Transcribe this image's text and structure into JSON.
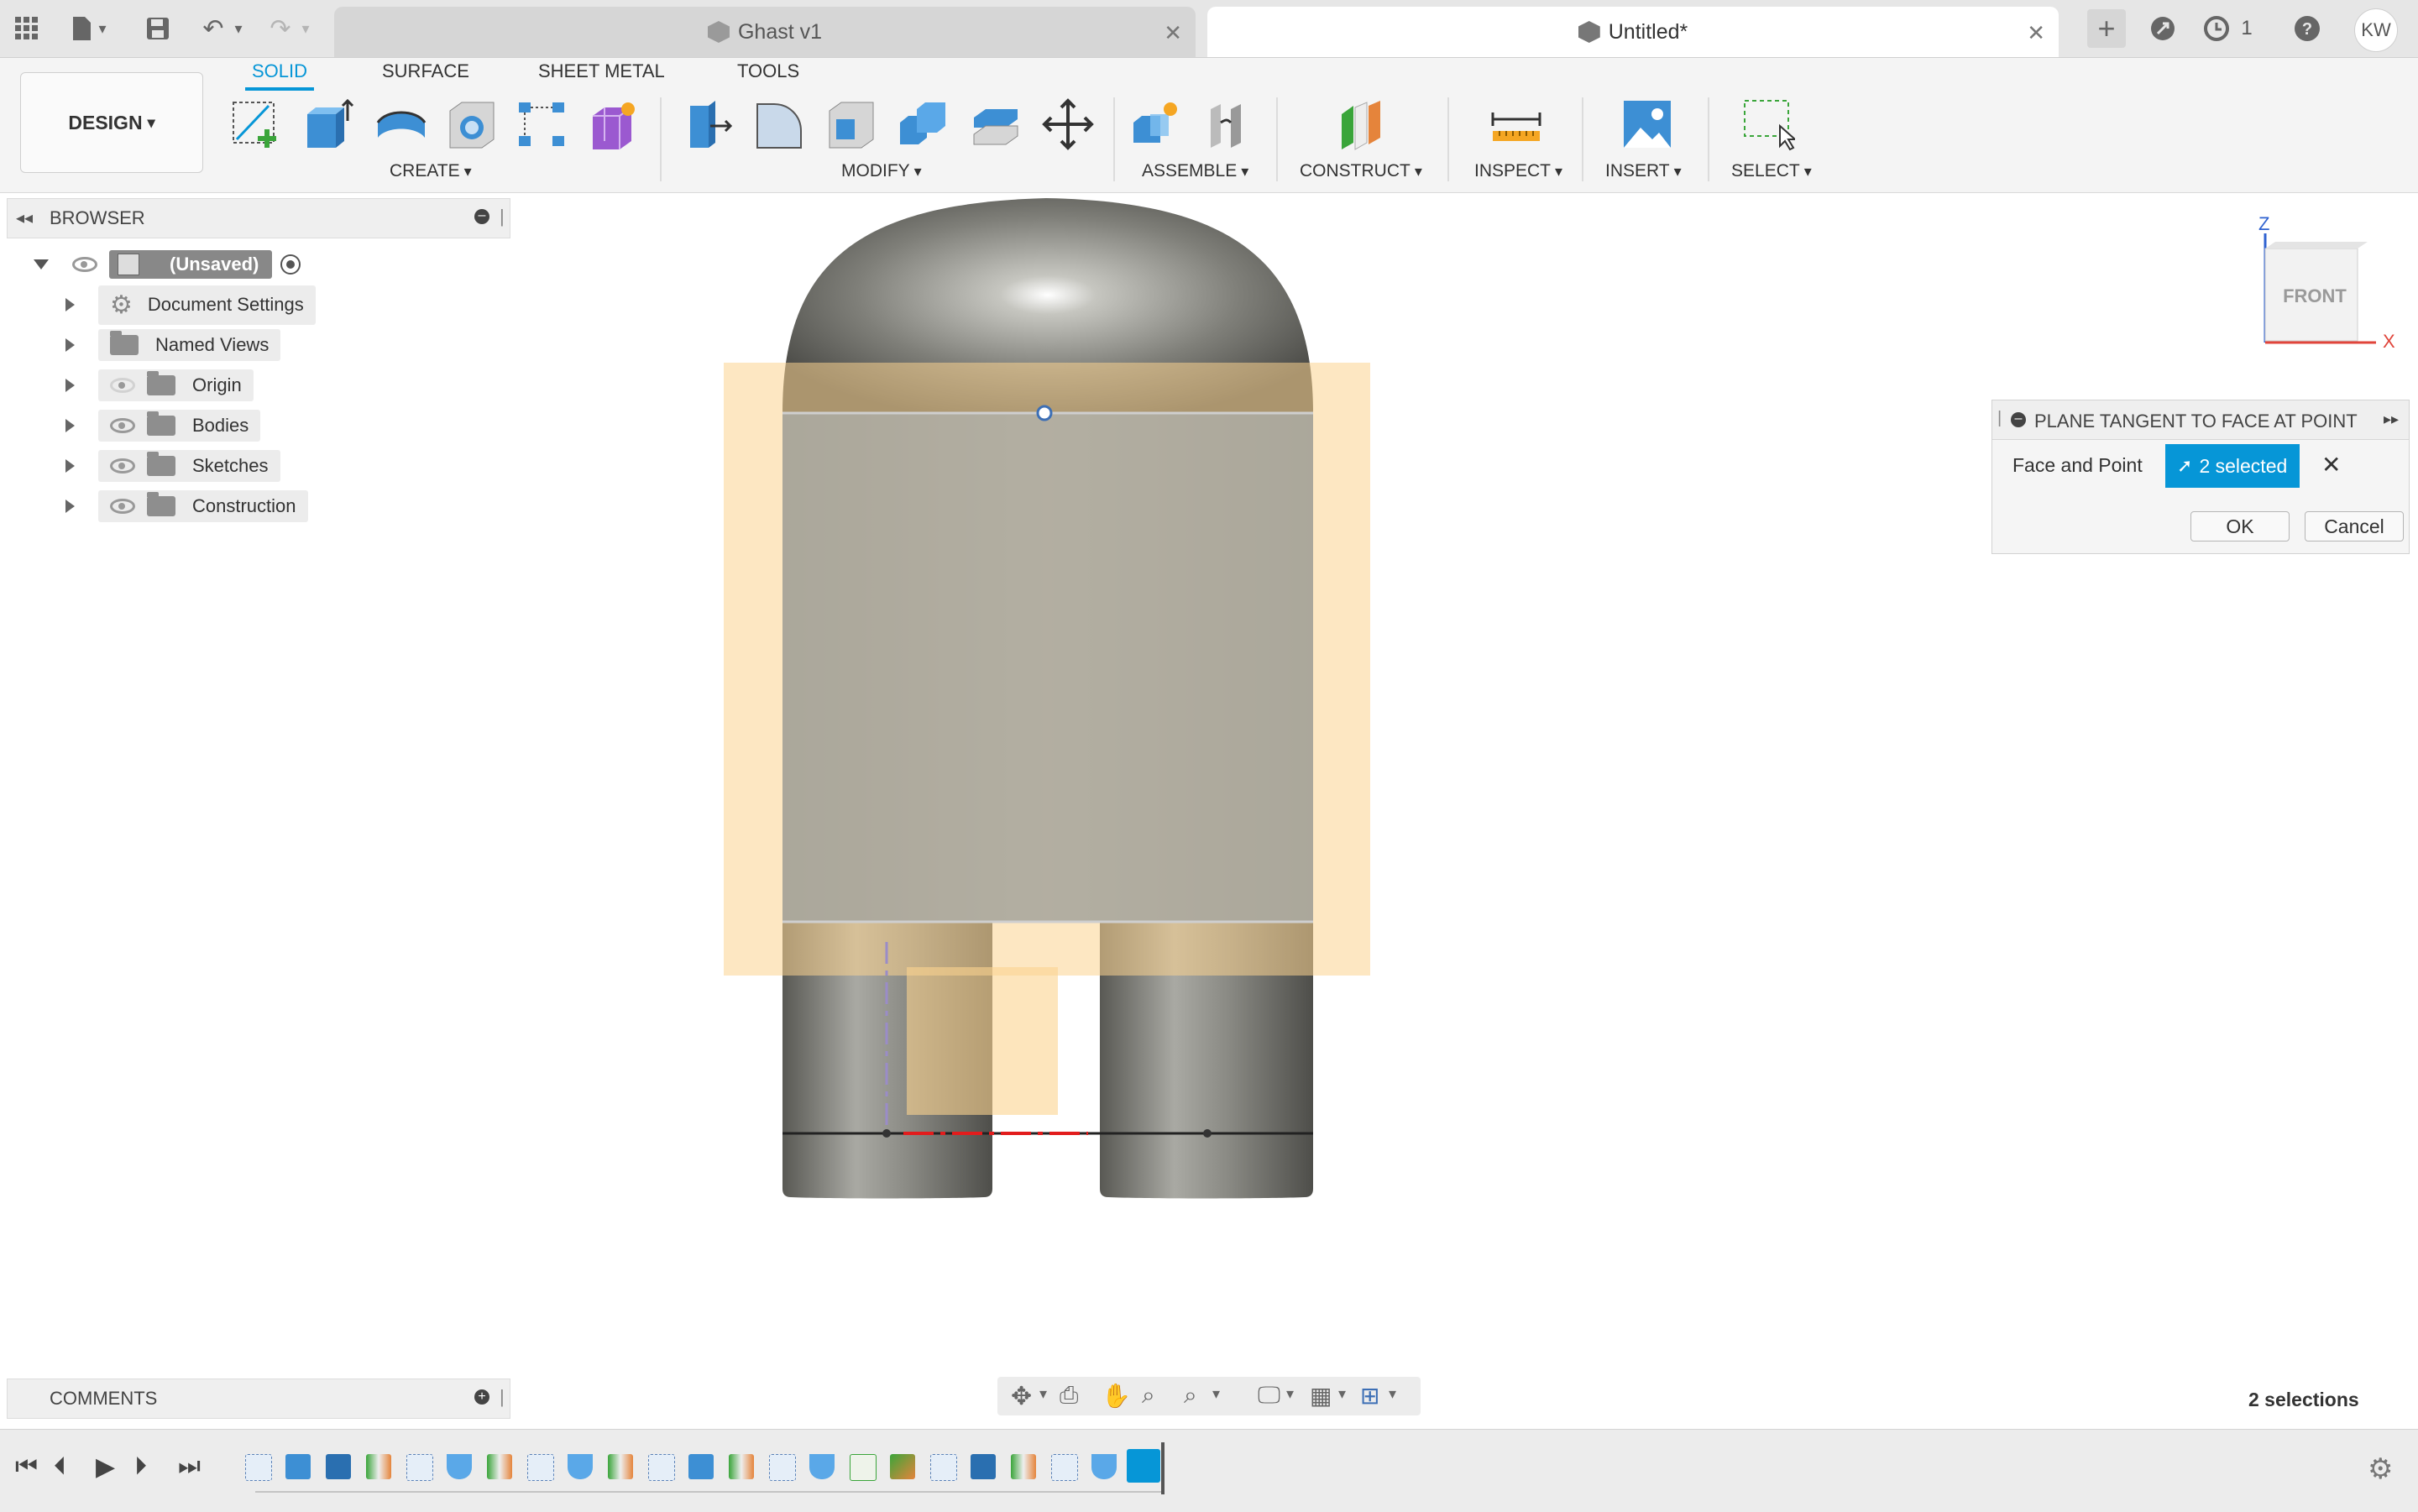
{
  "tabbar": {
    "tabs": [
      {
        "label": "Ghast v1",
        "active": false
      },
      {
        "label": "Untitled*",
        "active": true
      }
    ],
    "job_count": "1",
    "user_initials": "KW"
  },
  "ribbon": {
    "workspace_button": "DESIGN",
    "tabs": [
      "SOLID",
      "SURFACE",
      "SHEET METAL",
      "TOOLS"
    ],
    "active_tab": "SOLID",
    "groups": {
      "create": "CREATE",
      "modify": "MODIFY",
      "assemble": "ASSEMBLE",
      "construct": "CONSTRUCT",
      "inspect": "INSPECT",
      "insert": "INSERT",
      "select": "SELECT"
    }
  },
  "browser": {
    "title": "BROWSER",
    "root": "(Unsaved)",
    "items": [
      {
        "label": "Document Settings",
        "icon": "gear-icon"
      },
      {
        "label": "Named Views",
        "icon": "folder-icon"
      },
      {
        "label": "Origin",
        "icon": "folder-icon"
      },
      {
        "label": "Bodies",
        "icon": "folder-icon"
      },
      {
        "label": "Sketches",
        "icon": "folder-icon"
      },
      {
        "label": "Construction",
        "icon": "folder-icon"
      }
    ]
  },
  "viewcube": {
    "axis_z": "Z",
    "axis_x": "X",
    "face_label": "FRONT"
  },
  "dialog": {
    "title": "PLANE TANGENT TO FACE AT POINT",
    "field_label": "Face and Point",
    "selection_value": "2 selected",
    "ok_label": "OK",
    "cancel_label": "Cancel"
  },
  "comments": {
    "title": "COMMENTS"
  },
  "status": {
    "selections": "2 selections"
  },
  "colors": {
    "accent": "#0696d7",
    "body_blue": "#5b82b7",
    "plane_orange": "#fbd48f",
    "metal_grey": "#8a8a86"
  }
}
